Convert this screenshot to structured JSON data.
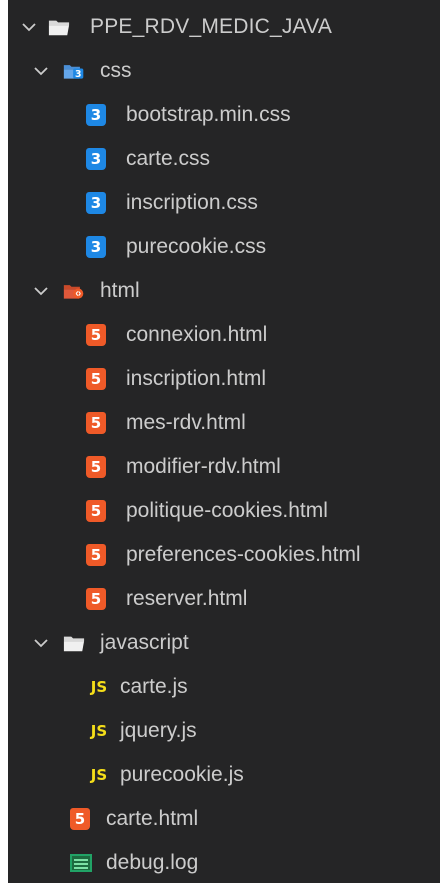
{
  "explorer": {
    "root": {
      "label": "PPE_RDV_MEDIC_JAVA",
      "icon": "folder-open-icon",
      "expanded": true
    },
    "folders": [
      {
        "label": "css",
        "icon": "folder-css-open-icon",
        "expanded": true,
        "files": [
          {
            "label": "bootstrap.min.css",
            "icon": "css3-file-icon"
          },
          {
            "label": "carte.css",
            "icon": "css3-file-icon"
          },
          {
            "label": "inscription.css",
            "icon": "css3-file-icon"
          },
          {
            "label": "purecookie.css",
            "icon": "css3-file-icon"
          }
        ]
      },
      {
        "label": "html",
        "icon": "folder-html-open-icon",
        "expanded": true,
        "files": [
          {
            "label": "connexion.html",
            "icon": "html5-file-icon"
          },
          {
            "label": "inscription.html",
            "icon": "html5-file-icon"
          },
          {
            "label": "mes-rdv.html",
            "icon": "html5-file-icon"
          },
          {
            "label": "modifier-rdv.html",
            "icon": "html5-file-icon"
          },
          {
            "label": "politique-cookies.html",
            "icon": "html5-file-icon"
          },
          {
            "label": "preferences-cookies.html",
            "icon": "html5-file-icon"
          },
          {
            "label": "reserver.html",
            "icon": "html5-file-icon"
          }
        ]
      },
      {
        "label": "javascript",
        "icon": "folder-open-icon",
        "expanded": true,
        "files": [
          {
            "label": "carte.js",
            "icon": "js-file-icon",
            "badge": "JS"
          },
          {
            "label": "jquery.js",
            "icon": "js-file-icon",
            "badge": "JS"
          },
          {
            "label": "purecookie.js",
            "icon": "js-file-icon",
            "badge": "JS"
          }
        ]
      }
    ],
    "root_files": [
      {
        "label": "carte.html",
        "icon": "html5-file-icon"
      },
      {
        "label": "debug.log",
        "icon": "log-file-icon"
      }
    ],
    "icon_glyphs": {
      "css": "3",
      "html": "5"
    },
    "colors": {
      "background": "#252526",
      "text": "#cccccc",
      "css_icon": "#1e88e5",
      "html_icon": "#ef5a28",
      "js_icon": "#f5de19",
      "folder": "#e8e8e8",
      "log_icon": "#21a366"
    }
  }
}
